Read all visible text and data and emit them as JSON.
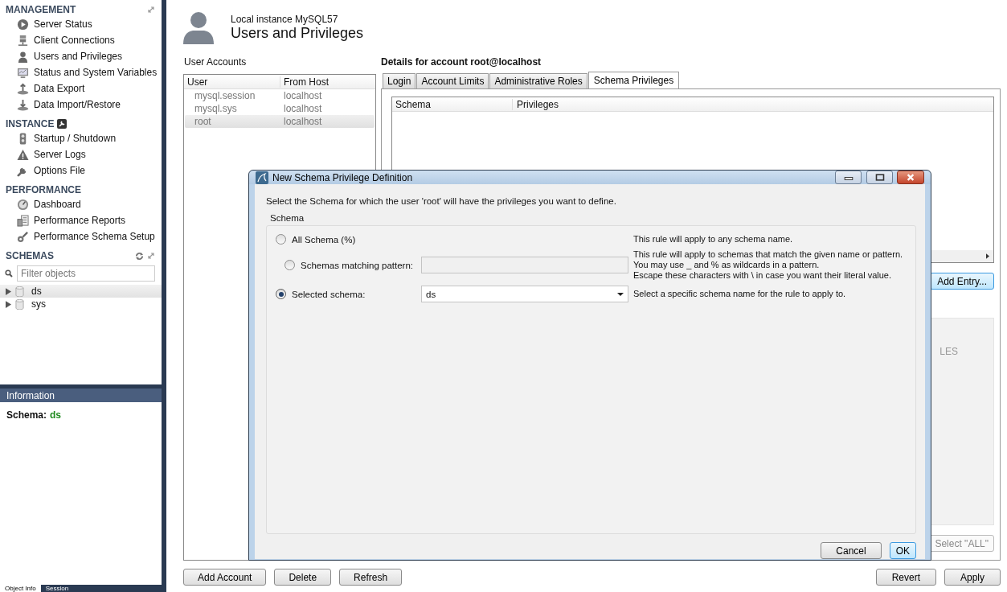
{
  "sidebar": {
    "sections": [
      {
        "title": "MANAGEMENT",
        "items": [
          "Server Status",
          "Client Connections",
          "Users and Privileges",
          "Status and System Variables",
          "Data Export",
          "Data Import/Restore"
        ]
      },
      {
        "title": "INSTANCE",
        "items": [
          "Startup / Shutdown",
          "Server Logs",
          "Options File"
        ]
      },
      {
        "title": "PERFORMANCE",
        "items": [
          "Dashboard",
          "Performance Reports",
          "Performance Schema Setup"
        ]
      }
    ],
    "schemas": {
      "title": "SCHEMAS",
      "filter_placeholder": "Filter objects",
      "items": [
        {
          "label": "ds",
          "selected": true,
          "expanded": false
        },
        {
          "label": "sys",
          "selected": false,
          "expanded": false
        }
      ]
    },
    "information": {
      "title": "Information",
      "label": "Schema:",
      "value": "ds"
    },
    "bottom_tabs": [
      {
        "label": "Object Info",
        "selected": true
      },
      {
        "label": "Session",
        "selected": false
      }
    ]
  },
  "header": {
    "subtitle": "Local instance MySQL57",
    "title": "Users and Privileges"
  },
  "user_accounts": {
    "label": "User Accounts",
    "columns": [
      "User",
      "From Host"
    ],
    "rows": [
      {
        "user": "mysql.session",
        "host": "localhost",
        "selected": false
      },
      {
        "user": "mysql.sys",
        "host": "localhost",
        "selected": false
      },
      {
        "user": "root",
        "host": "localhost",
        "selected": true
      }
    ]
  },
  "details": {
    "title": "Details for account root@localhost",
    "tabs": [
      {
        "label": "Login",
        "selected": false
      },
      {
        "label": "Account Limits",
        "selected": false
      },
      {
        "label": "Administrative Roles",
        "selected": false
      },
      {
        "label": "Schema Privileges",
        "selected": true
      }
    ],
    "columns": [
      "Schema",
      "Privileges"
    ],
    "add_entry": "Add Entry...",
    "panel_fragment": "LES",
    "select_all": "Select \"ALL\""
  },
  "left_buttons": [
    "Add Account",
    "Delete",
    "Refresh"
  ],
  "right_buttons": [
    "Revert",
    "Apply"
  ],
  "dialog": {
    "title": "New Schema Privilege Definition",
    "instruction": "Select the Schema for which the user 'root' will have the privileges you want to define.",
    "group_label": "Schema",
    "options": [
      {
        "kind": "plain",
        "label": "All Schema (%)",
        "selected": false,
        "description": "This rule will apply to any schema name."
      },
      {
        "kind": "field",
        "label": "Schemas matching pattern:",
        "selected": false,
        "disabled": true,
        "description": "This rule will apply to schemas that match the given name or pattern.\nYou may use _ and % as wildcards in a pattern.\nEscape these characters with \\ in case you want their literal value."
      },
      {
        "kind": "combo",
        "label": "Selected schema:",
        "selected": true,
        "value": "ds",
        "description": "Select a specific schema name for the rule to apply to."
      }
    ],
    "buttons": [
      {
        "label": "Cancel",
        "default": false
      },
      {
        "label": "OK",
        "default": true
      }
    ]
  }
}
